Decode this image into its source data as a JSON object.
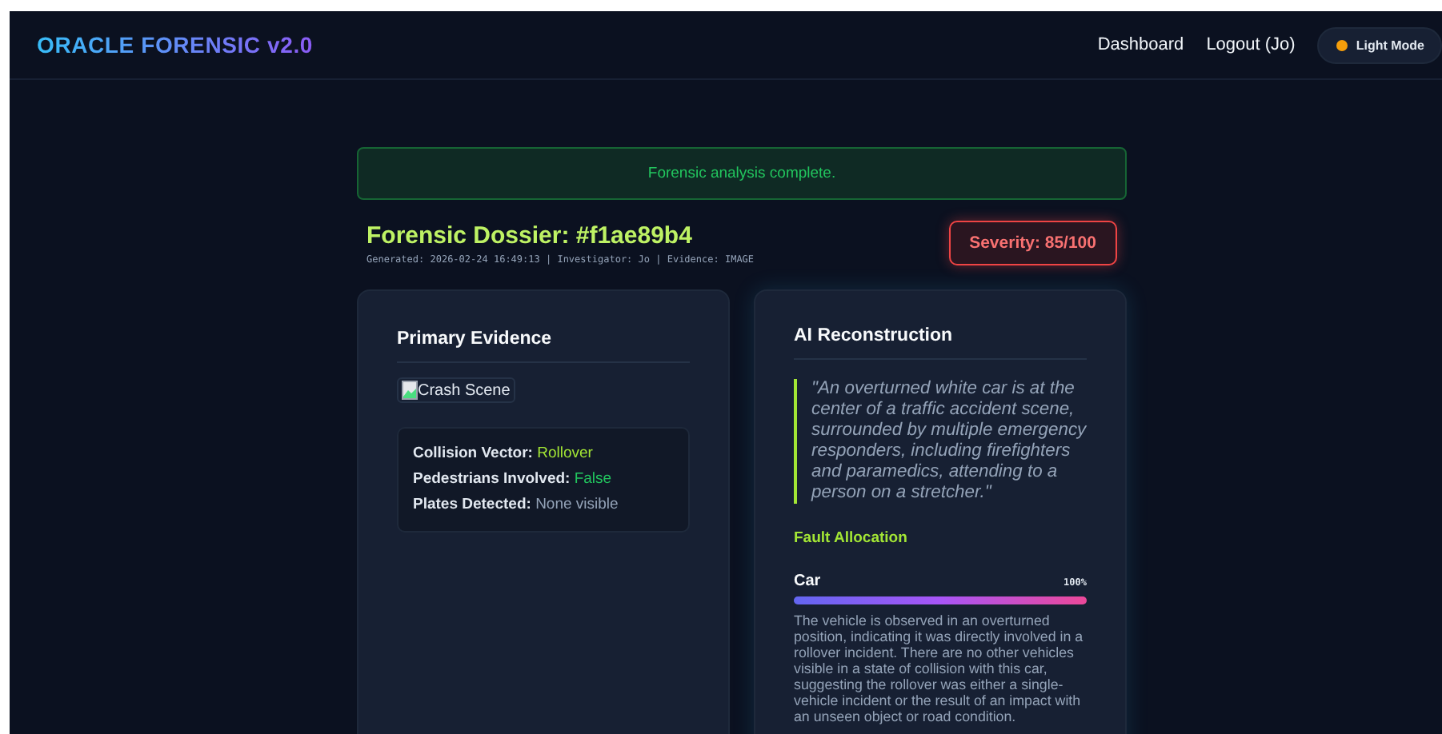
{
  "header": {
    "logo": "ORACLE FORENSIC v2.0",
    "nav": [
      "Dashboard",
      "Logout (Jo)"
    ],
    "theme_button": "Light Mode"
  },
  "alert": "Forensic analysis complete.",
  "dossier": {
    "title": "Forensic Dossier: #f1ae89b4",
    "meta": "Generated: 2026-02-24 16:49:13 | Investigator: Jo | Evidence: IMAGE",
    "severity": "Severity: 85/100"
  },
  "primary_evidence": {
    "title": "Primary Evidence",
    "image_alt": "Crash Scene",
    "facts": [
      {
        "label": "Collision Vector:",
        "value": "Rollover",
        "color": "#a3e635"
      },
      {
        "label": "Pedestrians Involved:",
        "value": "False",
        "color": "#22c55e"
      },
      {
        "label": "Plates Detected:",
        "value": "None visible",
        "color": "#94a3b8"
      }
    ]
  },
  "reconstruction": {
    "title": "AI Reconstruction",
    "quote": "\"An overturned white car is at the center of a traffic accident scene, surrounded by multiple emergency responders, including firefighters and paramedics, attending to a person on a stretcher.\"",
    "fault_title": "Fault Allocation",
    "faults": [
      {
        "name": "Car",
        "percent": "100%",
        "level": 1,
        "description": "The vehicle is observed in an overturned position, indicating it was directly involved in a rollover incident. There are no other vehicles visible in a state of collision with this car, suggesting the rollover was either a single-vehicle incident or the result of an impact with an unseen object or road condition."
      }
    ]
  }
}
